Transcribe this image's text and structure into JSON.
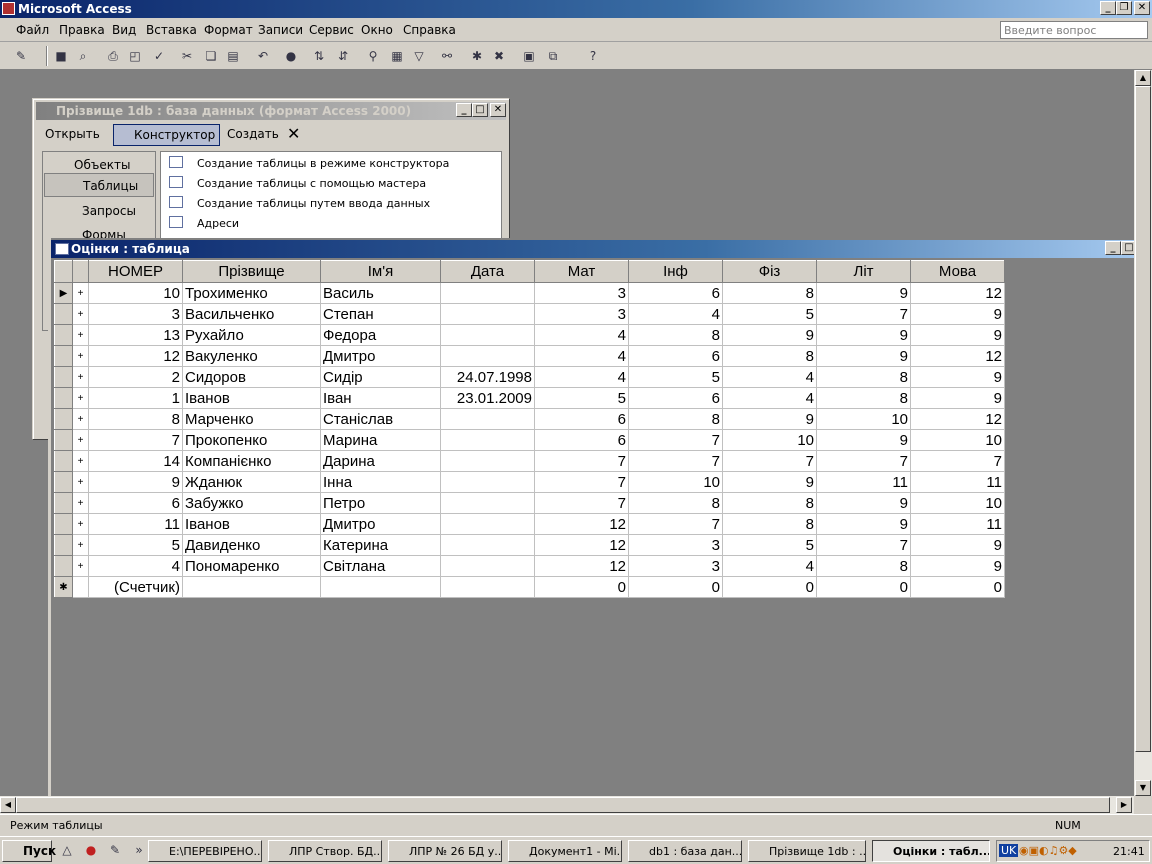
{
  "app": {
    "title": "Microsoft Access"
  },
  "menu": [
    "Файл",
    "Правка",
    "Вид",
    "Вставка",
    "Формат",
    "Записи",
    "Сервис",
    "Окно",
    "Справка"
  ],
  "ask": {
    "placeholder": "Введите вопрос"
  },
  "db": {
    "title": "Прізвище 1db : база данных (формат Access 2000)",
    "open": "Открыть",
    "design": "Конструктор",
    "create": "Создать",
    "objects_header": "Объекты",
    "side": [
      "Таблицы",
      "Запросы",
      "Формы"
    ],
    "items": [
      "Создание таблицы в режиме конструктора",
      "Создание таблицы с помощью мастера",
      "Создание таблицы путем ввода данных",
      "Адреси"
    ]
  },
  "table": {
    "title": "Оцінки : таблица",
    "columns": [
      "НОМЕР",
      "Прізвище",
      "Ім'я",
      "Дата",
      "Мат",
      "Інф",
      "Фіз",
      "Літ",
      "Мова"
    ],
    "rows": [
      [
        "10",
        "Трохименко",
        "Василь",
        "",
        "3",
        "6",
        "8",
        "9",
        "12"
      ],
      [
        "3",
        "Васильченко",
        "Степан",
        "",
        "3",
        "4",
        "5",
        "7",
        "9"
      ],
      [
        "13",
        "Рухайло",
        "Федора",
        "",
        "4",
        "8",
        "9",
        "9",
        "9"
      ],
      [
        "12",
        "Вакуленко",
        "Дмитро",
        "",
        "4",
        "6",
        "8",
        "9",
        "12"
      ],
      [
        "2",
        "Сидоров",
        "Сидір",
        "24.07.1998",
        "4",
        "5",
        "4",
        "8",
        "9"
      ],
      [
        "1",
        "Іванов",
        "Іван",
        "23.01.2009",
        "5",
        "6",
        "4",
        "8",
        "9"
      ],
      [
        "8",
        "Марченко",
        "Станіслав",
        "",
        "6",
        "8",
        "9",
        "10",
        "12"
      ],
      [
        "7",
        "Прокопенко",
        "Марина",
        "",
        "6",
        "7",
        "10",
        "9",
        "10"
      ],
      [
        "14",
        "Компанієнко",
        "Дарина",
        "",
        "7",
        "7",
        "7",
        "7",
        "7"
      ],
      [
        "9",
        "Жданюк",
        "Інна",
        "",
        "7",
        "10",
        "9",
        "11",
        "11"
      ],
      [
        "6",
        "Забужко",
        "Петро",
        "",
        "7",
        "8",
        "8",
        "9",
        "10"
      ],
      [
        "11",
        "Іванов",
        "Дмитро",
        "",
        "12",
        "7",
        "8",
        "9",
        "11"
      ],
      [
        "5",
        "Давиденко",
        "Катерина",
        "",
        "12",
        "3",
        "5",
        "7",
        "9"
      ],
      [
        "4",
        "Пономаренко",
        "Світлана",
        "",
        "12",
        "3",
        "4",
        "8",
        "9"
      ]
    ],
    "new_row": [
      "(Счетчик)",
      "",
      "",
      "",
      "0",
      "0",
      "0",
      "0",
      "0"
    ]
  },
  "status": {
    "left": "Режим таблицы",
    "num": "NUM"
  },
  "taskbar": {
    "start": "Пуск",
    "clock": "21:41",
    "lang": "UK",
    "tasks": [
      "E:\\ПЕРЕВІРЕНО...",
      "ЛПР Створ. БД...",
      "ЛПР № 26 БД у...",
      "Документ1 - Mi...",
      "db1 : база дан...",
      "Прізвище 1db : ...",
      "Оцінки : табл..."
    ]
  }
}
